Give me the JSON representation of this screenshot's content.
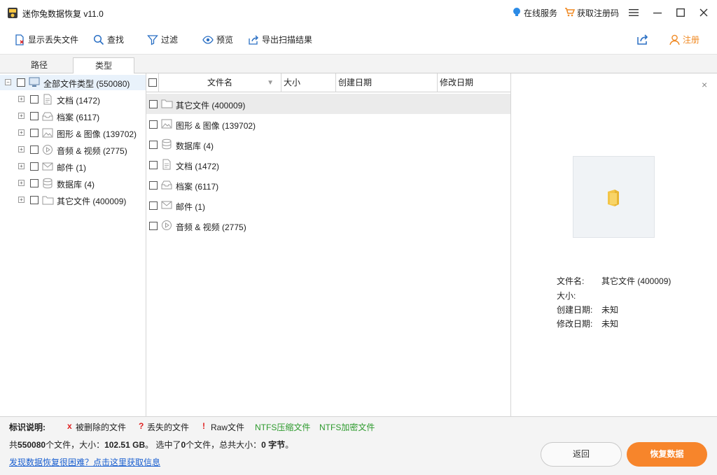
{
  "window": {
    "title": "迷你兔数据恢复 v11.0",
    "online_service": "在线服务",
    "get_code": "获取注册码"
  },
  "toolbar": {
    "show_lost": "显示丢失文件",
    "find": "查找",
    "filter": "过滤",
    "preview": "预览",
    "export": "导出扫描结果",
    "register": "注册"
  },
  "tabs": [
    "路径",
    "类型"
  ],
  "tree": {
    "root": "全部文件类型 (550080)",
    "items": [
      {
        "label": "文档 (1472)",
        "icon": "document-icon"
      },
      {
        "label": "档案 (6117)",
        "icon": "archive-icon"
      },
      {
        "label": "图形 & 图像 (139702)",
        "icon": "image-icon"
      },
      {
        "label": "音频 & 视频 (2775)",
        "icon": "media-icon"
      },
      {
        "label": "邮件 (1)",
        "icon": "mail-icon"
      },
      {
        "label": "数据库 (4)",
        "icon": "database-icon"
      },
      {
        "label": "其它文件 (400009)",
        "icon": "folder-icon"
      }
    ]
  },
  "filelist": {
    "columns": [
      "文件名",
      "大小",
      "创建日期",
      "修改日期"
    ],
    "rows": [
      {
        "label": "其它文件 (400009)",
        "icon": "folder-icon"
      },
      {
        "label": "图形 & 图像 (139702)",
        "icon": "image-icon"
      },
      {
        "label": "数据库 (4)",
        "icon": "database-icon"
      },
      {
        "label": "文档 (1472)",
        "icon": "document-icon"
      },
      {
        "label": "档案 (6117)",
        "icon": "archive-icon"
      },
      {
        "label": "邮件 (1)",
        "icon": "mail-icon"
      },
      {
        "label": "音频 & 视频 (2775)",
        "icon": "media-icon"
      }
    ]
  },
  "preview": {
    "close": "×",
    "filename_label": "文件名:",
    "filename_value": "其它文件 (400009)",
    "size_label": "大小:",
    "created_label": "创建日期:",
    "created_value": "未知",
    "modified_label": "修改日期:",
    "modified_value": "未知"
  },
  "legend": {
    "title": "标识说明:",
    "deleted_mark": "x",
    "deleted": "被删除的文件",
    "lost_mark": "?",
    "lost": "丢失的文件",
    "raw_mark": "!",
    "raw": "Raw文件",
    "ntfs_compressed": "NTFS压缩文件",
    "ntfs_encrypted": "NTFS加密文件"
  },
  "status": {
    "summary_prefix": "共",
    "total_files": "550080",
    "summary_mid": "个文件，大小：",
    "total_size": "102.51 GB",
    "summary_mid2": "。 选中了",
    "selected_count": "0",
    "summary_mid3": "个文件，总共大小：",
    "selected_size": "0 字节",
    "summary_end": "。",
    "help_link": "发现数据恢复很困难？点击这里获取信息",
    "back": "返回",
    "recover": "恢复数据"
  },
  "colors": {
    "accent_orange": "#f7852b",
    "link_blue": "#1a5fd0",
    "deleted_red": "#e02020",
    "ntfs_green": "#2c9a2c"
  }
}
